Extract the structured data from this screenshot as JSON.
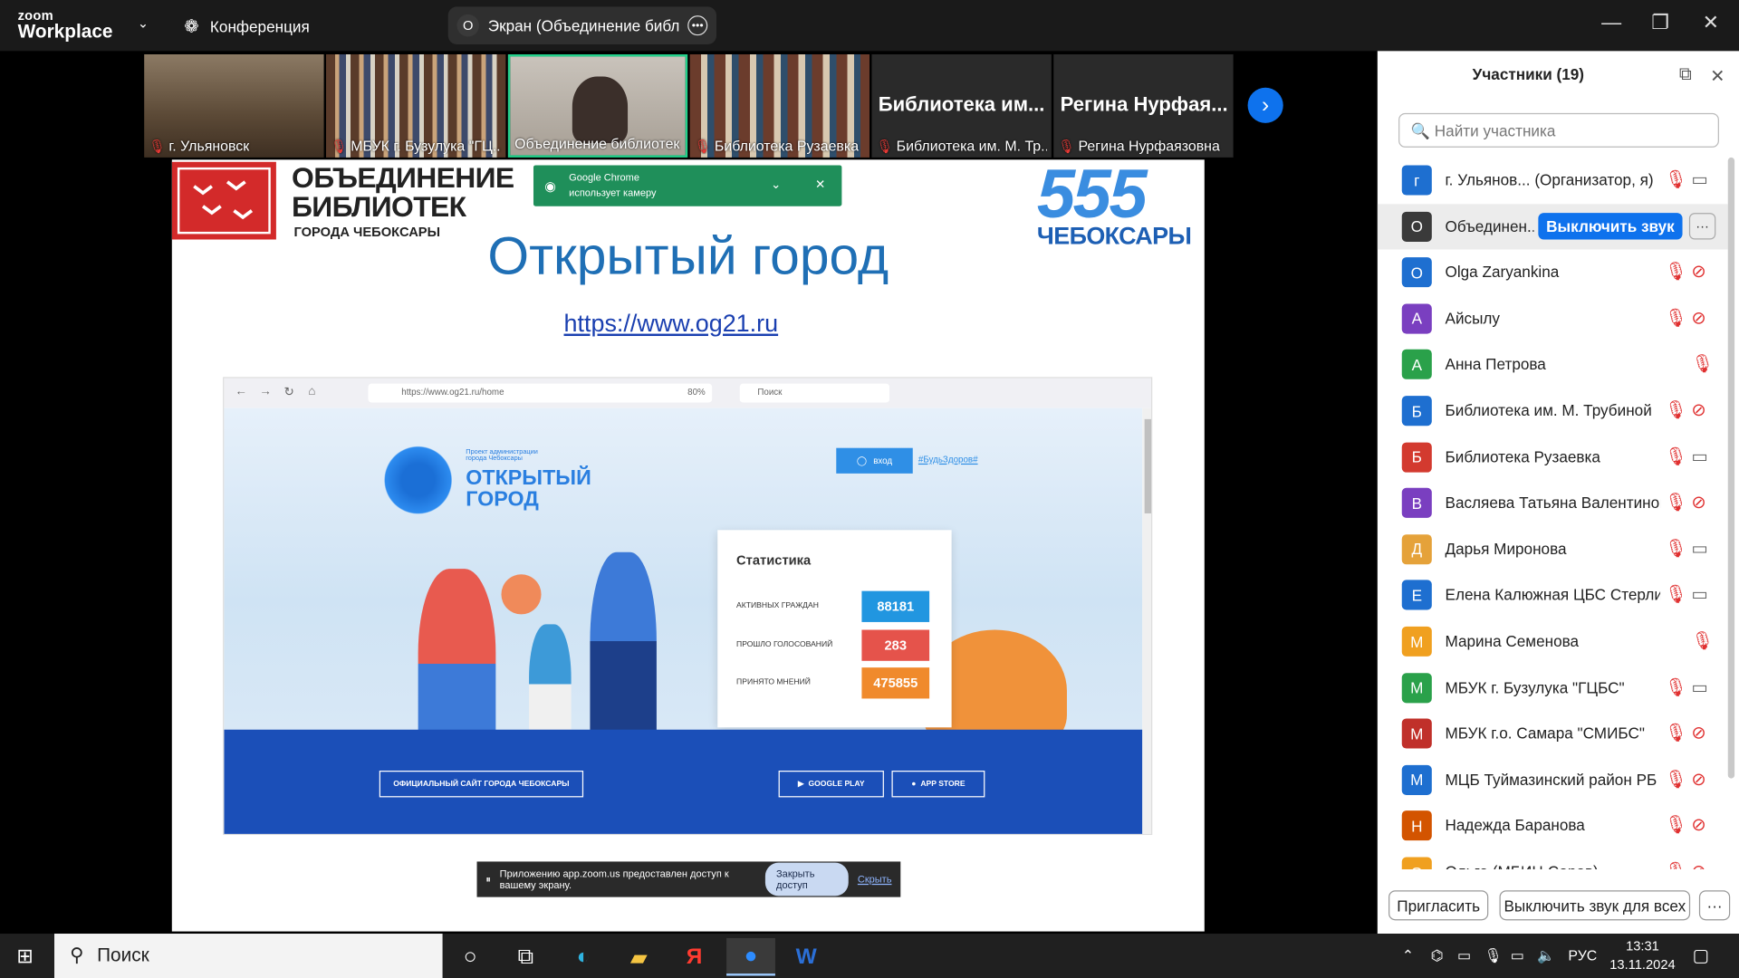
{
  "app": {
    "logo_top": "zoom",
    "logo_bottom": "Workplace",
    "meeting_menu": "Конференция",
    "share_avatar": "О",
    "share_label": "Экран (Объединение библиоте",
    "win_min": "—",
    "win_restore": "❐",
    "win_close": "✕"
  },
  "strip": {
    "tiles": [
      {
        "name": "г. Ульяновск"
      },
      {
        "name": "МБУК г. Бузулука \"ГЦ..."
      },
      {
        "name": "Объединение библиотек..."
      },
      {
        "name": "Библиотека Рузаевка"
      },
      {
        "name": "Библиотека им. М. Тр...",
        "big": "Библиотека им..."
      },
      {
        "name": "Регина Нурфаязовна",
        "big": "Регина Нурфая..."
      }
    ],
    "next": "›"
  },
  "slide": {
    "org_title_1": "ОБЪЕДИНЕНИЕ",
    "org_title_2": "БИБЛИОТЕК",
    "org_sub": "ГОРОДА ЧЕБОКСАРЫ",
    "title": "Открытый город",
    "link": "https://www.og21.ru",
    "anniv_number": "555",
    "anniv_city": "ЧЕБОКСАРЫ",
    "chrome_toast": {
      "line1": "Google Chrome",
      "line2": "использует камеру"
    },
    "inner": {
      "url": "https://www.og21.ru/home",
      "zoom": "80%",
      "search": "Поиск",
      "project_small_1": "Проект администрации",
      "project_small_2": "города Чебоксары",
      "og_title_1": "ОТКРЫТЫЙ",
      "og_title_2": "ГОРОД",
      "login": "вход",
      "tag": "#БудьЗдоров#",
      "stats_title": "Статистика",
      "stats": [
        {
          "label": "АКТИВНЫХ ГРАЖДАН",
          "value": "88181",
          "color": "#2196e0"
        },
        {
          "label": "ПРОШЛО ГОЛОСОВАНИЙ",
          "value": "283",
          "color": "#e5534b"
        },
        {
          "label": "ПРИНЯТО МНЕНИЙ",
          "value": "475855",
          "color": "#f08a2c"
        }
      ],
      "btn_official": "ОФИЦИАЛЬНЫЙ САЙТ ГОРОДА ЧЕБОКСАРЫ",
      "btn_gplay": "GOOGLE PLAY",
      "btn_appstore": "APP STORE"
    },
    "deny_bar": {
      "text": "Приложению app.zoom.us предоставлен доступ к вашему экрану.",
      "stop": "Закрыть доступ",
      "hide": "Скрыть"
    }
  },
  "panel": {
    "title": "Участники (19)",
    "search_placeholder": "Найти участника",
    "mute_label": "Выключить звук",
    "more": "···",
    "participants": [
      {
        "initial": "г",
        "name": "г. Ульянов... (Организатор, я)",
        "color": "#1e6fd0",
        "cam": "on"
      },
      {
        "initial": "О",
        "name": "Объединен...",
        "color": "#3a3a3a",
        "cam": "none",
        "selected": true
      },
      {
        "initial": "O",
        "name": "Olga Zaryankina",
        "color": "#1e6fd0",
        "cam": "off"
      },
      {
        "initial": "А",
        "name": "Айсылу",
        "color": "#7a3fc0",
        "cam": "off"
      },
      {
        "initial": "А",
        "name": "Анна Петрова",
        "color": "#2aa14a",
        "cam": "none"
      },
      {
        "initial": "Б",
        "name": "Библиотека им. М. Трубиной",
        "color": "#1e6fd0",
        "cam": "off"
      },
      {
        "initial": "Б",
        "name": "Библиотека Рузаевка",
        "color": "#d33a2f",
        "cam": "on"
      },
      {
        "initial": "В",
        "name": "Васляева Татьяна Валентиновна",
        "color": "#7a3fc0",
        "cam": "off"
      },
      {
        "initial": "Д",
        "name": "Дарья Миронова",
        "color": "#e5a23a",
        "cam": "on"
      },
      {
        "initial": "Е",
        "name": "Елена Калюжная ЦБС Стерлита...",
        "color": "#1e6fd0",
        "cam": "on"
      },
      {
        "initial": "М",
        "name": "Марина Семенова",
        "color": "#f0a020",
        "cam": "none"
      },
      {
        "initial": "М",
        "name": "МБУК г. Бузулука \"ГЦБС\"",
        "color": "#2aa14a",
        "cam": "on"
      },
      {
        "initial": "М",
        "name": "МБУК г.о. Самара \"СМИБС\"",
        "color": "#c0302a",
        "cam": "off"
      },
      {
        "initial": "М",
        "name": "МЦБ Туймазинский район РБ",
        "color": "#1e6fd0",
        "cam": "off"
      },
      {
        "initial": "Н",
        "name": "Надежда Баранова",
        "color": "#d35400",
        "cam": "off"
      },
      {
        "initial": "О",
        "name": "Ольга (МБИЦ Саров)",
        "color": "#f0a020",
        "cam": "off"
      }
    ],
    "invite": "Пригласить",
    "mute_all": "Выключить звук для всех",
    "footer_more": "···"
  },
  "taskbar": {
    "search": "Поиск",
    "lang": "РУС",
    "time": "13:31",
    "date": "13.11.2024"
  }
}
